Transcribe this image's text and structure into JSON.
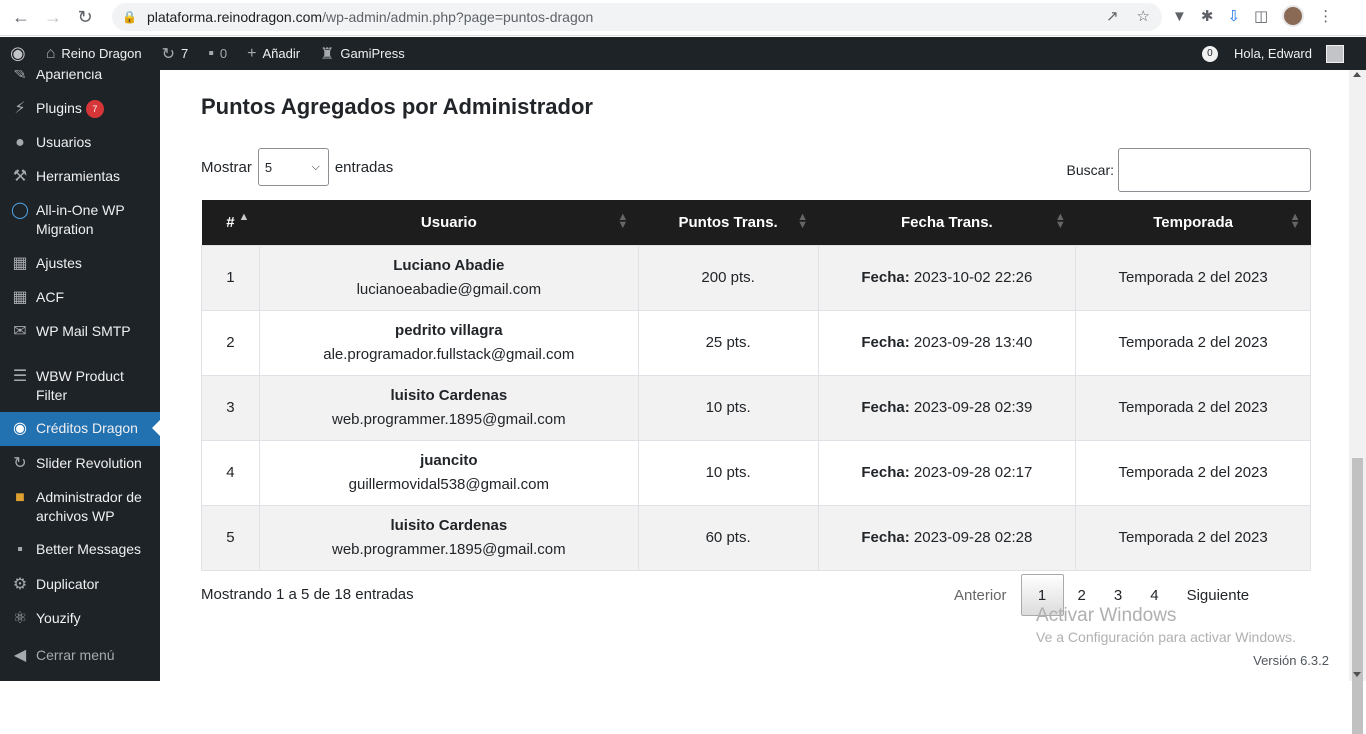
{
  "browser": {
    "url_host": "plataforma.reinodragon.com",
    "url_path": "/wp-admin/admin.php?page=puntos-dragon"
  },
  "adminbar": {
    "site_name": "Reino Dragon",
    "updates_count": "7",
    "comments_count": "0",
    "add_label": "Añadir",
    "gamipress_label": "GamiPress",
    "notif_count": "0",
    "greeting": "Hola, Edward"
  },
  "sidebar": {
    "items": [
      {
        "label": "Apariencia",
        "icon": "paintbrush-icon"
      },
      {
        "label": "Plugins",
        "icon": "plugin-icon",
        "badge": "7"
      },
      {
        "label": "Usuarios",
        "icon": "users-icon"
      },
      {
        "label": "Herramientas",
        "icon": "wrench-icon"
      },
      {
        "label": "All-in-One WP Migration",
        "icon": "migration-icon"
      },
      {
        "label": "Ajustes",
        "icon": "settings-icon"
      },
      {
        "label": "ACF",
        "icon": "acf-icon"
      },
      {
        "label": "WP Mail SMTP",
        "icon": "mail-icon"
      },
      {
        "label": "WBW Product Filter",
        "icon": "filter-icon"
      },
      {
        "label": "Créditos Dragon",
        "icon": "dragon-icon"
      },
      {
        "label": "Slider Revolution",
        "icon": "slider-icon"
      },
      {
        "label": "Administrador de archivos WP",
        "icon": "folder-icon"
      },
      {
        "label": "Better Messages",
        "icon": "messages-icon"
      },
      {
        "label": "Duplicator",
        "icon": "duplicator-icon"
      },
      {
        "label": "Youzify",
        "icon": "youzify-icon"
      },
      {
        "label": "Cerrar menú",
        "icon": "collapse-icon"
      }
    ]
  },
  "main": {
    "title": "Puntos Agregados por Administrador",
    "show_label": "Mostrar",
    "show_value": "5",
    "entries_label": "entradas",
    "search_label": "Buscar:",
    "columns": [
      "#",
      "Usuario",
      "Puntos Trans.",
      "Fecha Trans.",
      "Temporada"
    ],
    "date_prefix": "Fecha:",
    "rows": [
      {
        "n": "1",
        "name": "Luciano Abadie",
        "email": "lucianoeabadie@gmail.com",
        "points": "200 pts.",
        "date": "2023-10-02 22:26",
        "season": "Temporada 2 del 2023"
      },
      {
        "n": "2",
        "name": "pedrito villagra",
        "email": "ale.programador.fullstack@gmail.com",
        "points": "25 pts.",
        "date": "2023-09-28 13:40",
        "season": "Temporada 2 del 2023"
      },
      {
        "n": "3",
        "name": "luisito Cardenas",
        "email": "web.programmer.1895@gmail.com",
        "points": "10 pts.",
        "date": "2023-09-28 02:39",
        "season": "Temporada 2 del 2023"
      },
      {
        "n": "4",
        "name": "juancito",
        "email": "guillermovidal538@gmail.com",
        "points": "10 pts.",
        "date": "2023-09-28 02:17",
        "season": "Temporada 2 del 2023"
      },
      {
        "n": "5",
        "name": "luisito Cardenas",
        "email": "web.programmer.1895@gmail.com",
        "points": "60 pts.",
        "date": "2023-09-28 02:28",
        "season": "Temporada 2 del 2023"
      }
    ],
    "info": "Mostrando 1 a 5 de 18 entradas",
    "pagination": {
      "prev": "Anterior",
      "pages": [
        "1",
        "2",
        "3",
        "4"
      ],
      "current": "1",
      "next": "Siguiente"
    },
    "watermark_title": "Activar Windows",
    "watermark_sub": "Ve a Configuración para activar Windows.",
    "version": "Versión 6.3.2"
  }
}
